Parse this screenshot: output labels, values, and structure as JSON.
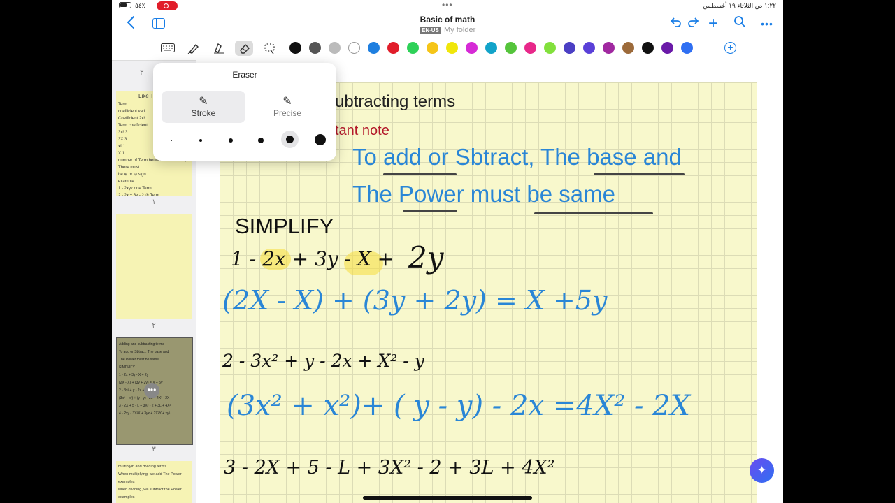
{
  "status_bar": {
    "battery_pct": "٥٤٪",
    "datetime": "١:٢٢ ص   الثلاثاء ١٩ أغسطس"
  },
  "header": {
    "title": "Basic of math",
    "language": "EN-US",
    "folder": "My folder"
  },
  "toolbar": {
    "tools": [
      "keyboard-icon",
      "pen-icon",
      "highlighter-icon",
      "eraser-icon",
      "lasso-icon"
    ],
    "selected_tool": "eraser",
    "colors": [
      "#111111",
      "#555555",
      "#bbbbbb",
      "#ffffff",
      "#1f7fe0",
      "#e11d2a",
      "#2ed158",
      "#f5c518",
      "#f0e60a",
      "#d62ad6",
      "#12a3c9",
      "#55c43b",
      "#e8288a",
      "#82e03c",
      "#4b3fc4",
      "#5a40d8",
      "#a028a0",
      "#9c6a3a",
      "#111111",
      "#6a1aa8",
      "#2f6ff2"
    ]
  },
  "eraser_popover": {
    "title": "Eraser",
    "modes": [
      "Stroke",
      "Precise"
    ],
    "selected_mode": "Stroke",
    "sizes_count": 6,
    "selected_size": 5
  },
  "sidebar": {
    "pages": [
      {
        "number": "١",
        "preview": {
          "heading": "Like T",
          "lines": [
            "Term",
            "coefficient  vari",
            "Coefficient 2x³",
            "Term  coefficient",
            "3x²  3",
            "3X   3",
            "x²   1",
            "X    1",
            "number of Term  between each Term, There must",
            "be ⊕ or ⊖ sign",
            "example",
            "1 - 2xyz     one Term",
            "2 - 2x + 3y - 2    ③ Term"
          ]
        }
      },
      {
        "number": "٢",
        "preview": {
          "lines": []
        }
      },
      {
        "number": "٣",
        "preview": {
          "lines": [
            "Adding and subtracting terms",
            "To add or Sbtract, The base and",
            "The Power must be same",
            "SIMPLIFY",
            "1 - 2x + 3y - X + 2y",
            "(2X - X) + (3y + 2y) = X + 5y",
            "2 - 3x² + y - 2x + X² - y",
            "(3x² + x²) + (y - y) - 2x = 4X² - 2X",
            "3 - 2X + 5 - L + 3X² - 2 + 3L + 4X²",
            "4 - 2xy - 3Y²X + 3yx + 2X²Y + xy²"
          ]
        }
      },
      {
        "number": "",
        "preview": {
          "lines": [
            "multiplyin and dividing terms",
            "When multiplying, we add The Power",
            "examples",
            "when dividing, we subtract the Power",
            "examples"
          ]
        }
      }
    ]
  },
  "page": {
    "heading_partial": "ubtracting terms",
    "note_partial": "tant note",
    "rule_line1": "To add or Sbtract, The base and",
    "rule_line2": "The Power must be same",
    "simplify": "SIMPLIFY",
    "p1": "1 - 2x + 3y - X +",
    "p1_tail": "2y",
    "p1_work": "(2X - X) + (3y + 2y) = X +5y",
    "p2": "2 - 3x² + y - 2x + X² - y",
    "p2_work": "(3x² + x²)+ (  y - y) - 2x  =4X² - 2X",
    "p3": "3 - 2X + 5 - L + 3X² - 2 + 3L + 4X²"
  }
}
